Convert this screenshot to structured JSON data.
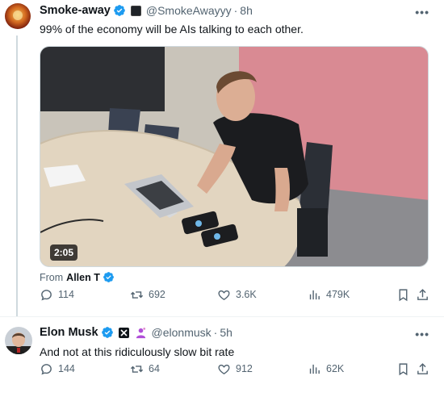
{
  "tweet1": {
    "author_name": "Smoke-away",
    "author_handle": "@SmokeAwayyy",
    "separator": "·",
    "time": "8h",
    "text": "99% of the economy will be AIs talking to each other.",
    "video_duration": "2:05",
    "from_label": "From",
    "from_name": "Allen T",
    "replies": "114",
    "reposts": "692",
    "likes": "3.6K",
    "views": "479K"
  },
  "tweet2": {
    "author_name": "Elon Musk",
    "author_handle": "@elonmusk",
    "separator": "·",
    "time": "5h",
    "text": "And not at this ridiculously slow bit rate",
    "replies": "144",
    "reposts": "64",
    "likes": "912",
    "views": "62K"
  },
  "more_label": "•••",
  "colors": {
    "verified_blue": "#1d9bf0",
    "icon_gray": "#536471",
    "wall_pink": "#d98a93"
  }
}
